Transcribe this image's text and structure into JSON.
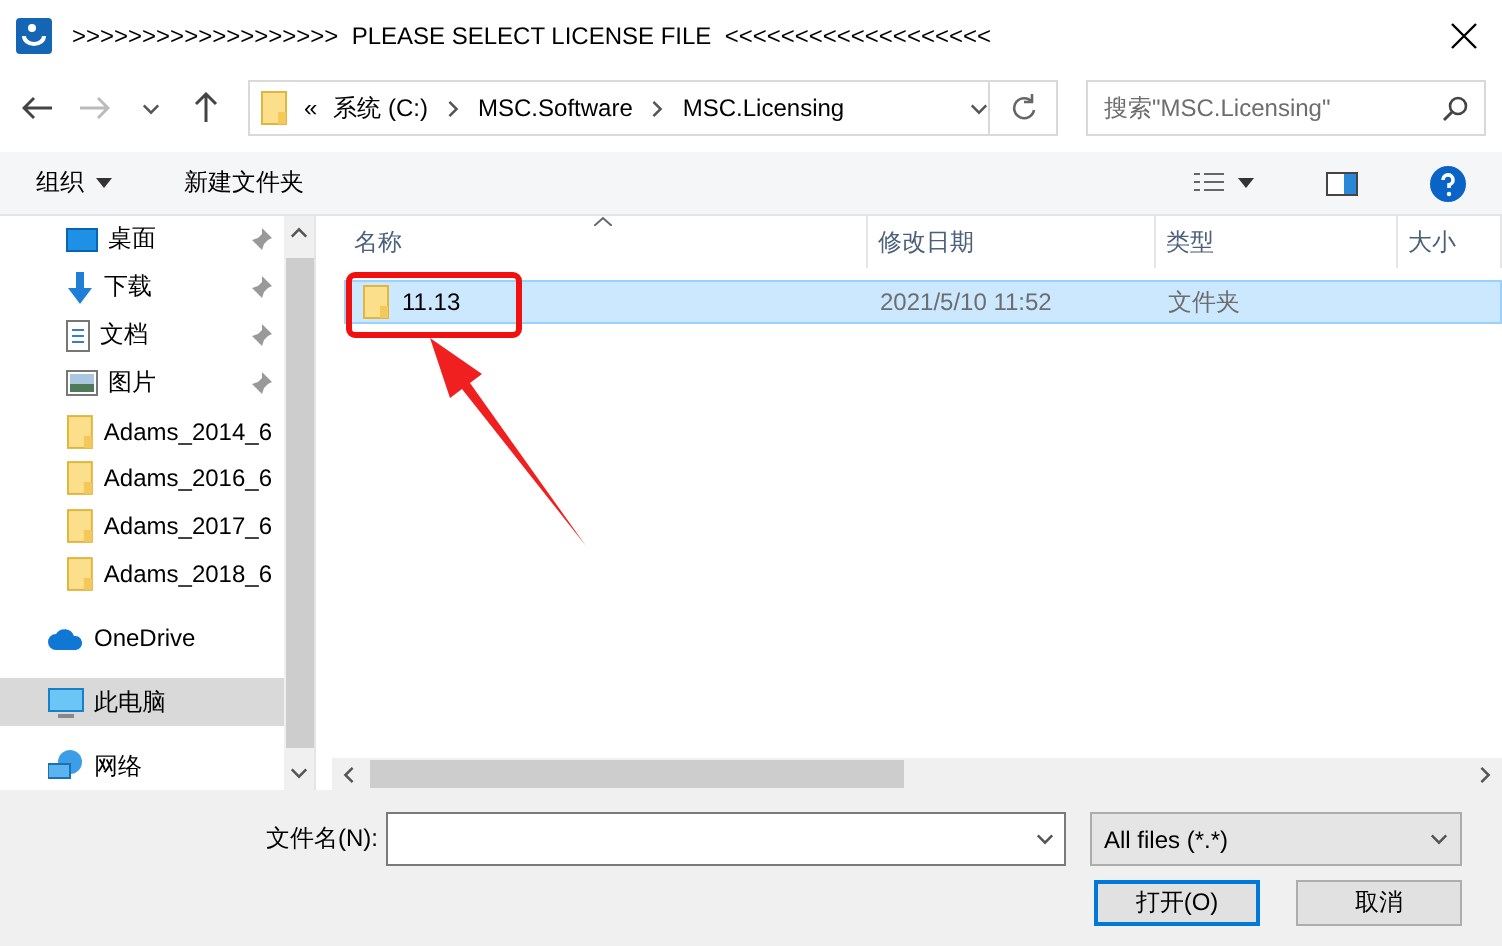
{
  "window": {
    "title": ">>>>>>>>>>>>>>>>>>>  PLEASE SELECT LICENSE FILE  <<<<<<<<<<<<<<<<<<<"
  },
  "address": {
    "path": [
      "系统 (C:)",
      "MSC.Software",
      "MSC.Licensing"
    ],
    "overflow": "«"
  },
  "search": {
    "placeholder": "搜索\"MSC.Licensing\""
  },
  "toolbar": {
    "organize": "组织",
    "new_folder": "新建文件夹"
  },
  "sidebar": {
    "items": [
      {
        "label": "桌面",
        "kind": "desktop",
        "pinned": true,
        "selected": false
      },
      {
        "label": "下载",
        "kind": "download",
        "pinned": true,
        "selected": false
      },
      {
        "label": "文档",
        "kind": "document",
        "pinned": true,
        "selected": false
      },
      {
        "label": "图片",
        "kind": "picture",
        "pinned": true,
        "selected": false
      },
      {
        "label": "Adams_2014_6",
        "kind": "folder",
        "pinned": false,
        "selected": false
      },
      {
        "label": "Adams_2016_6",
        "kind": "folder",
        "pinned": false,
        "selected": false
      },
      {
        "label": "Adams_2017_6",
        "kind": "folder",
        "pinned": false,
        "selected": false
      },
      {
        "label": "Adams_2018_6",
        "kind": "folder",
        "pinned": false,
        "selected": false
      },
      {
        "label": "OneDrive",
        "kind": "cloud",
        "pinned": false,
        "selected": false
      },
      {
        "label": "此电脑",
        "kind": "pc",
        "pinned": false,
        "selected": true
      },
      {
        "label": "网络",
        "kind": "network",
        "pinned": false,
        "selected": false
      }
    ]
  },
  "table": {
    "columns": [
      "名称",
      "修改日期",
      "类型",
      "大小"
    ],
    "rows": [
      {
        "name": "11.13",
        "modified": "2021/5/10 11:52",
        "type": "文件夹",
        "selected": true
      }
    ]
  },
  "footer": {
    "filename_label": "文件名(N):",
    "filter": "All files (*.*)",
    "open": "打开(O)",
    "cancel": "取消"
  }
}
